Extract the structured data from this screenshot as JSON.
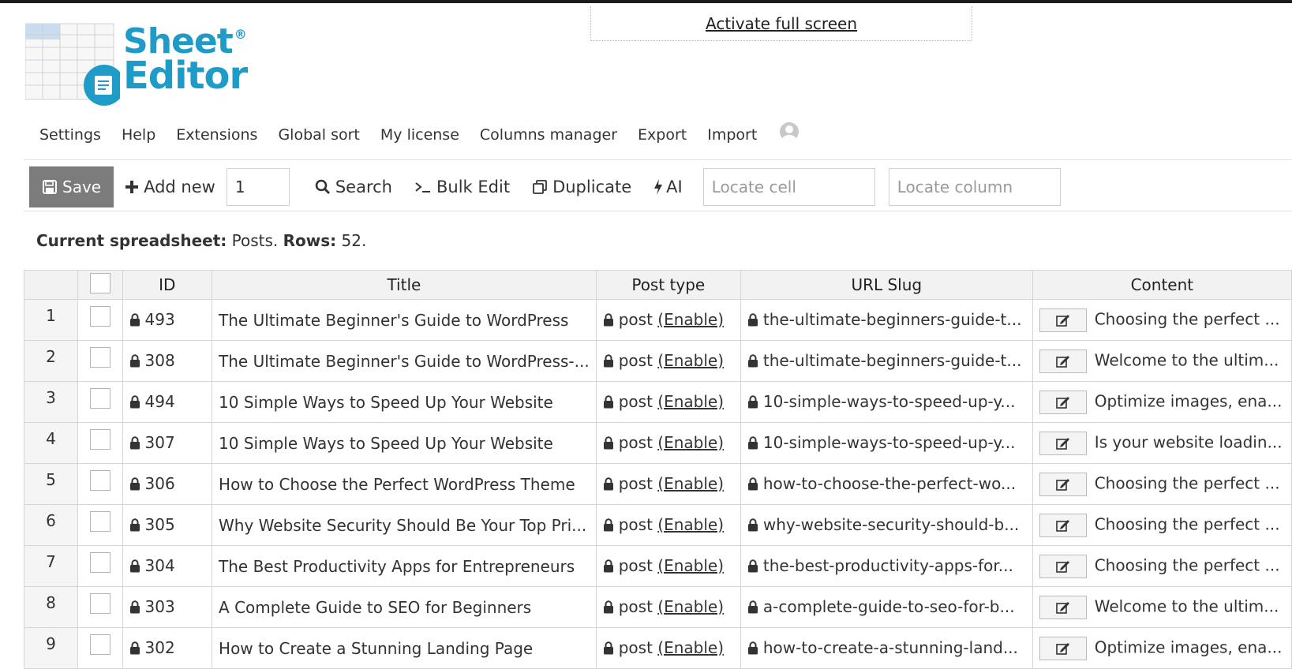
{
  "fullscreen": {
    "label": "Activate full screen"
  },
  "logo": {
    "line1": "Sheet",
    "line2": "Editor",
    "reg": "®"
  },
  "menu": {
    "items": [
      "Settings",
      "Help",
      "Extensions",
      "Global sort",
      "My license",
      "Columns manager",
      "Export",
      "Import"
    ]
  },
  "toolbar": {
    "save_label": "Save",
    "add_new_label": "Add new",
    "add_count": "1",
    "search_label": "Search",
    "bulk_edit_label": "Bulk Edit",
    "duplicate_label": "Duplicate",
    "ai_label": "AI",
    "locate_cell_placeholder": "Locate cell",
    "locate_column_placeholder": "Locate column"
  },
  "status": {
    "label_sheet": "Current spreadsheet:",
    "sheet_value": "Posts.",
    "label_rows": "Rows:",
    "rows_value": "52."
  },
  "table": {
    "headers": {
      "id": "ID",
      "title": "Title",
      "post_type": "Post type",
      "slug": "URL Slug",
      "content": "Content"
    },
    "enable_label": "(Enable)",
    "rows": [
      {
        "num": "1",
        "id": "493",
        "title": "The Ultimate Beginner's Guide to WordPress",
        "post_type": "post",
        "slug": "the-ultimate-beginners-guide-t...",
        "content": "Choosing the perfect ..."
      },
      {
        "num": "2",
        "id": "308",
        "title": "The Ultimate Beginner's Guide to WordPress-...",
        "post_type": "post",
        "slug": "the-ultimate-beginners-guide-t...",
        "content": "Welcome to the ultim..."
      },
      {
        "num": "3",
        "id": "494",
        "title": "10 Simple Ways to Speed Up Your Website",
        "post_type": "post",
        "slug": "10-simple-ways-to-speed-up-y...",
        "content": "Optimize images, ena..."
      },
      {
        "num": "4",
        "id": "307",
        "title": "10 Simple Ways to Speed Up Your Website",
        "post_type": "post",
        "slug": "10-simple-ways-to-speed-up-y...",
        "content": "Is your website loadin..."
      },
      {
        "num": "5",
        "id": "306",
        "title": "How to Choose the Perfect WordPress Theme",
        "post_type": "post",
        "slug": "how-to-choose-the-perfect-wo...",
        "content": "Choosing the perfect ..."
      },
      {
        "num": "6",
        "id": "305",
        "title": "Why Website Security Should Be Your Top Pri...",
        "post_type": "post",
        "slug": "why-website-security-should-b...",
        "content": "Choosing the perfect ..."
      },
      {
        "num": "7",
        "id": "304",
        "title": "The Best Productivity Apps for Entrepreneurs",
        "post_type": "post",
        "slug": "the-best-productivity-apps-for...",
        "content": "Choosing the perfect ..."
      },
      {
        "num": "8",
        "id": "303",
        "title": "A Complete Guide to SEO for Beginners",
        "post_type": "post",
        "slug": "a-complete-guide-to-seo-for-b...",
        "content": "Welcome to the ultim..."
      },
      {
        "num": "9",
        "id": "302",
        "title": "How to Create a Stunning Landing Page",
        "post_type": "post",
        "slug": "how-to-create-a-stunning-land...",
        "content": "Optimize images, ena..."
      }
    ]
  },
  "colors": {
    "brand": "#1f9bc8",
    "save_bg": "#7b7b7b",
    "header_bg": "#f2f2f2"
  }
}
